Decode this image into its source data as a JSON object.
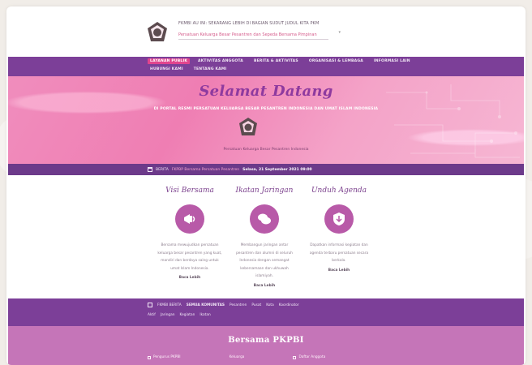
{
  "header": {
    "line1": "FKMBI AU INI: SEKARANG LEBIH DI BAGIAN SUDUT JUDUL KITA PKM",
    "line2": "Persatuan Keluarga Besar Pesantren dan Sepeda Bersama Pimpinan"
  },
  "nav": {
    "row1": [
      "LAYANAN PUBLIK",
      "AKTIVITAS ANGGOTA",
      "BERITA & AKTIVITAS",
      "ORGANISASI & LEMBAGA",
      "INFORMASI LAIN"
    ],
    "row2": [
      "HUBUNGI KAMI",
      "TENTANG KAMI"
    ],
    "active_index": 0
  },
  "hero": {
    "title": "Selamat Datang",
    "subtitle": "DI PORTAL RESMI PERSATUAN KELUARGA BESAR PESANTREN INDONESIA DAN UMAT ISLAM INDONESIA",
    "caption": "Persatuan Keluarga Besar Pesantren Indonesia"
  },
  "datebar": {
    "prefix": "BERITA",
    "link": "FKPBP Bersama Persatuan Pesantren",
    "date": "Selasa, 21 September 2021 09:00"
  },
  "features": [
    {
      "title": "Visi Bersama",
      "icon": "megaphone-icon",
      "desc": "Bersama mewujudkan persatuan keluarga besar pesantren yang kuat, mandiri dan berdaya saing untuk umat Islam Indonesia.",
      "more": "Baca Lebih"
    },
    {
      "title": "Ikatan Jaringan",
      "icon": "chat-bubbles-icon",
      "desc": "Membangun jaringan antar pesantren dan alumni di seluruh Indonesia dengan semangat kebersamaan dan ukhuwah islamiyah.",
      "more": "Baca Lebih"
    },
    {
      "title": "Unduh Agenda",
      "icon": "shield-download-icon",
      "desc": "Dapatkan informasi kegiatan dan agenda terbaru persatuan secara berkala.",
      "more": "Baca Lebih"
    }
  ],
  "social": {
    "row1": [
      "FKMBI BERITA",
      "SEMUA KOMUNITAS",
      "Pesantren",
      "Pusat",
      "Kota",
      "Koordinator"
    ],
    "row2": [
      "Aktif",
      "Jaringan",
      "Kegiatan",
      "Ikatan"
    ]
  },
  "bottom": {
    "title": "Bersama PKPBI",
    "items": [
      "Pengurus PKPBI",
      "Keluarga",
      "Daftar Anggota"
    ]
  },
  "colors": {
    "nav": "#7c3f98",
    "accent": "#e1458e",
    "hero_title": "#8e3a9f",
    "feature_circle": "#b85aa8",
    "bottom": "#c575b8"
  }
}
